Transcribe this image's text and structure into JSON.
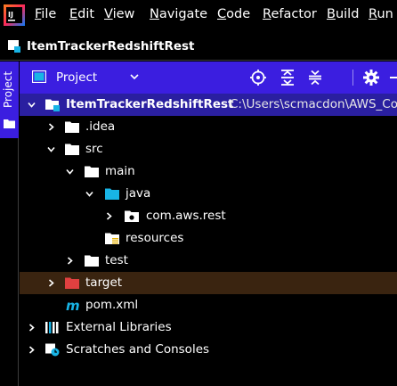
{
  "menubar": {
    "items": [
      {
        "label": "File",
        "mnemonic_index": 0
      },
      {
        "label": "Edit",
        "mnemonic_index": 0
      },
      {
        "label": "View",
        "mnemonic_index": 0
      },
      {
        "label": "Navigate",
        "mnemonic_index": 0
      },
      {
        "label": "Code",
        "mnemonic_index": 0
      },
      {
        "label": "Refactor",
        "mnemonic_index": 0
      },
      {
        "label": "Build",
        "mnemonic_index": 0
      },
      {
        "label": "Run",
        "mnemonic_index": 0
      }
    ]
  },
  "navbar": {
    "project_name": "ItemTrackerRedshiftRest"
  },
  "toolstrip": {
    "project_tab_label": "Project"
  },
  "project_panel": {
    "view_selector_label": "Project",
    "buttons": [
      "locate-icon",
      "expand-all-icon",
      "collapse-all-icon",
      "gear-icon",
      "hide-icon"
    ]
  },
  "tree": {
    "root": {
      "label": "ItemTrackerRedshiftRest",
      "path": "C:\\Users\\scmacdon\\AWS_Co"
    },
    "idea": {
      "label": ".idea"
    },
    "src": {
      "label": "src"
    },
    "main": {
      "label": "main"
    },
    "java": {
      "label": "java"
    },
    "package": {
      "label": "com.aws.rest"
    },
    "resources": {
      "label": "resources"
    },
    "test": {
      "label": "test"
    },
    "target": {
      "label": "target"
    },
    "pom": {
      "label": "pom.xml"
    },
    "external_libraries": {
      "label": "External Libraries"
    },
    "scratches": {
      "label": "Scratches and Consoles"
    }
  },
  "colors": {
    "accent": "#3b1ee0",
    "selection": "#2a1fa0",
    "excluded_folder": "#e04040",
    "source_folder": "#18b4e6",
    "target_row": "#3a2410"
  }
}
